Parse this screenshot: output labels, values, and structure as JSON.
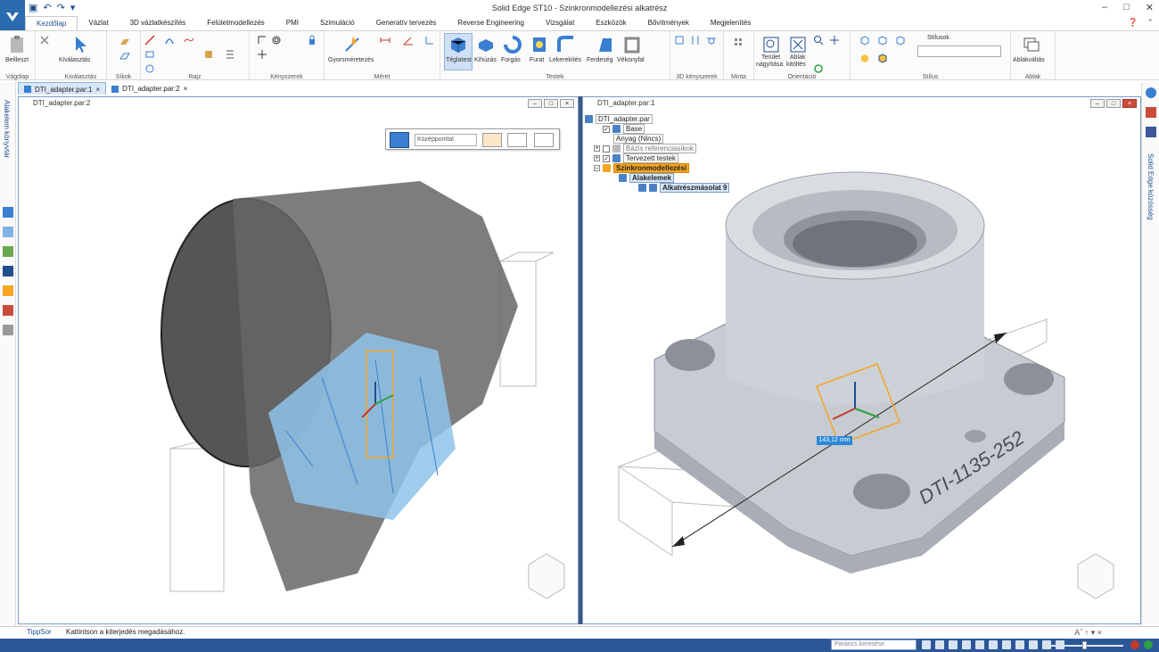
{
  "app": {
    "title": "Solid Edge ST10 - Szinkronmodellezési alkatrész",
    "colors": {
      "accent": "#2b6cb0",
      "status_bar": "#2b5797",
      "highlight": "#f6a623",
      "part": "#c7cbd2",
      "mesh": "#555555",
      "mesh_blue": "#8ec3ea"
    }
  },
  "ribbon": {
    "tabs": [
      "Kezdőlap",
      "Vázlat",
      "3D vázlatkészítés",
      "Felületmodellezés",
      "PMI",
      "Szimuláció",
      "Generatív tervezés",
      "Reverse Engineering",
      "Vizsgálat",
      "Eszközök",
      "Bővítmények",
      "Megjelenítés"
    ],
    "active_tab": "Kezdőlap",
    "groups": {
      "vagolap": "Vágólap",
      "kivalasztas": "Kiválasztás",
      "sikok": "Síkok",
      "rajz": "Rajz",
      "kenyszerek": "Kényszerek",
      "meret": "Méret",
      "testek": "Testek",
      "kenyszerek3d": "3D kényszerek",
      "minta": "Minta",
      "orientacio": "Orientáció",
      "stilus": "Stílus",
      "ablak": "Ablak"
    },
    "buttons": {
      "beilleszt": "Beilleszt",
      "kivalasztas": "Kiválasztás",
      "gyorsmeretezes": "Gyorsméretezés",
      "teglatest": "Téglatest",
      "kihuzas": "Kihúzás",
      "forgas": "Forgás",
      "furat": "Furat",
      "lekerekites": "Lekerekítés",
      "ferdeseg": "Ferdeség",
      "vekonyfal": "Vékonyfal",
      "terulet_nagyitasa_1": "Terület",
      "terulet_nagyitasa_2": "nagyítása",
      "ablak_kitoltes_1": "Ablak",
      "ablak_kitoltes_2": "kitöltés",
      "stilusok": "Stílusok",
      "ablakvaltas": "Ablakváltás"
    }
  },
  "documents": {
    "tabs": [
      "DTI_adapter.par:1",
      "DTI_adapter.par:2"
    ]
  },
  "left_pane": {
    "title": "DTI_adapter.par:2",
    "quickbar_select": "Középponttal"
  },
  "right_pane": {
    "title": "DTI_adapter.par:1",
    "dimension": "143,12 mm",
    "engraving": "DTI-1135-252",
    "tree": {
      "root": "DTI_adapter.par",
      "base": "Base",
      "anyag": "Anyag (Nincs)",
      "bazis": "Bázis referenciasíkok",
      "tervezett": "Tervezett testek",
      "szinkron": "Szinkronmodellezési",
      "alakelemek": "Alakelemek",
      "alkatresz": "Alkatrészmásolat 9"
    }
  },
  "rails": {
    "left": "Alakelem könyvtár",
    "right": "Solid Edge közösség"
  },
  "prompt": {
    "tab": "TippSor",
    "text": "Kattintson a kiterjedés megadásához."
  },
  "status": {
    "command_placeholder": "Parancs keresése"
  }
}
